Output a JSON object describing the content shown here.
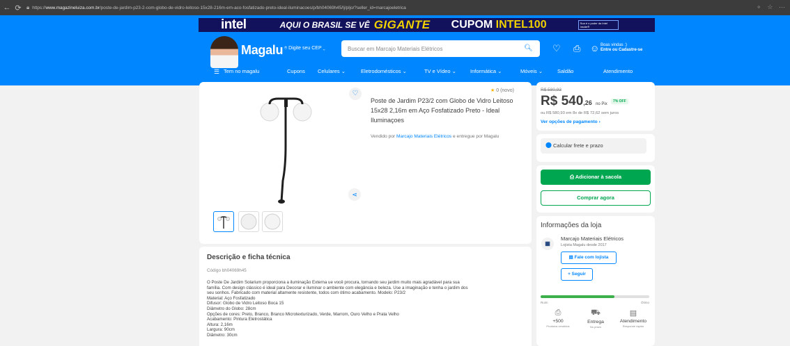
{
  "browser": {
    "url_prefix": "https://",
    "url_domain": "www.magazineluiza.com.br",
    "url_path": "/poste-de-jardim-p23-2-com-globo-de-vidro-leitoso-15x28-216m-em-aco-fosfatizado-preto-ideal-iluminacoes/p/bh04069h45/lj/pljo/?seller_id=marcajoeletrica"
  },
  "banner": {
    "brand": "intel",
    "headline": "AQUI O BRASIL SE VÊ",
    "headline_highlight": "GIGANTE",
    "coupon_label": "CUPOM",
    "coupon_code": "INTEL100",
    "badge": "Sua é o poder da Intel Inside®"
  },
  "header": {
    "logo": "Magalu",
    "cep_label": "Digite seu CEP",
    "search_placeholder": "Buscar em Marcajo Materiais Elétricos",
    "welcome_line1": "Boas vindas :)",
    "welcome_line2": "Entre ou Cadastre-se"
  },
  "nav": {
    "items": [
      {
        "label": "Tem no magalu"
      },
      {
        "label": "Cupons"
      },
      {
        "label": "Celulares ⌄"
      },
      {
        "label": "Eletrodomésticos ⌄"
      },
      {
        "label": "TV e Vídeo ⌄"
      },
      {
        "label": "Informática ⌄"
      },
      {
        "label": "Móveis ⌄"
      },
      {
        "label": "Saldão"
      },
      {
        "label": "Atendimento"
      }
    ]
  },
  "product": {
    "title": "Poste de Jardim P23/2 com Globo de Vidro Leitoso 15x28 2,16m em Aço Fosfatizado Preto - Ideal Iluminaçoes",
    "rating_text": "0 (novo)",
    "sold_by_label": "Vendido por",
    "seller_name": "Marcajo Materiais Elétricos",
    "delivered_by": "e entregue por Magalu"
  },
  "price": {
    "old": "R$ 580,93",
    "main": "R$ 540",
    "cents": ",26",
    "pix_label": "no Pix",
    "discount": "7% OFF",
    "installments": "ou R$ 580,93 em 8x de R$ 72,62 sem juros",
    "payment_link": "Ver opções de pagamento"
  },
  "shipping": {
    "label": "Calcular frete e prazo"
  },
  "buttons": {
    "add_to_bag": "Adicionar à sacola",
    "buy_now": "Comprar agora"
  },
  "store": {
    "heading": "Informações da loja",
    "name": "Marcajo Materiais Elétricos",
    "since": "Lojista Magalu desde 2017",
    "contact_button": "Fale com lojista",
    "follow_button": "+ Seguir",
    "reputation_low": "Ruim",
    "reputation_high": "Ótimo",
    "reputation_level": 0.68,
    "metrics": [
      {
        "value": "+500",
        "sub": "Produtos vendidos",
        "icon": "bag-icon"
      },
      {
        "value": "Entrega",
        "sub": "No prazo",
        "icon": "truck-icon"
      },
      {
        "value": "Atendimento",
        "sub": "Responde rápido",
        "icon": "chat-icon"
      }
    ]
  },
  "description": {
    "heading": "Descrição e ficha técnica",
    "code": "Código bh04069h45",
    "lines": [
      "O Poste De Jardim Solarium proporciona a iluminação Externa ue você procura, tornando seu jardim muito mais agradável para sua",
      "família. Com design clássico é ideal para Decorar e iluminar o ambiente com elegância e beleza. Use a imaginação e tenha o jardim dos",
      "seu sonhos. Fabricado com material altamente resistente, todos com ótimo acabamento. Modelo: P23/2",
      "Material: Aço Fosfatizado",
      "Difusor: Globo de Vidro Leitoso Boca 15",
      "Diâmetro do Globo: 28cm",
      "Opções de cores: Preto, Branco, Branco Microtexturizado, Verde, Marrom, Ouro Velho e Prata Velho",
      "Acabamento: Pintura Eletrostática",
      "Altura: 2,16m",
      "Largura: 90cm",
      "Diâmetro: 30cm"
    ]
  },
  "colors": {
    "brand_blue": "#0086ff",
    "buy_green": "#00a650",
    "banner_navy": "#11115c"
  }
}
